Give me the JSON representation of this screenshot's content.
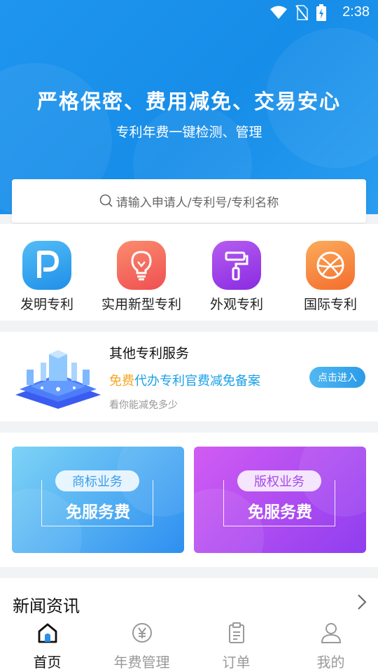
{
  "status_bar": {
    "time": "2:38"
  },
  "hero": {
    "slogan": "严格保密、费用减免、交易安心",
    "subslogan": "专利年费一键检测、管理"
  },
  "search": {
    "placeholder": "请输入申请人/专利号/专利名称"
  },
  "categories": [
    {
      "label": "发明专利",
      "icon": "p-letter-icon",
      "color": "#2fa3ef"
    },
    {
      "label": "实用新型专利",
      "icon": "lightbulb-icon",
      "color": "#f46a5c"
    },
    {
      "label": "外观专利",
      "icon": "paint-roller-icon",
      "color": "#9b3fe6"
    },
    {
      "label": "国际专利",
      "icon": "basketball-icon",
      "color": "#f7843a"
    }
  ],
  "service": {
    "title": "其他专利服务",
    "free": "免费",
    "desc": "代办专利官费减免备案",
    "hint": "看你能减免多少",
    "button": "点击进入"
  },
  "banners": [
    {
      "tag": "商标业务",
      "text": "免服务费"
    },
    {
      "tag": "版权业务",
      "text": "免服务费"
    }
  ],
  "news": {
    "title": "新闻资讯"
  },
  "tabbar": [
    {
      "label": "首页",
      "icon": "home-icon",
      "active": true
    },
    {
      "label": "年费管理",
      "icon": "yen-icon",
      "active": false
    },
    {
      "label": "订单",
      "icon": "clipboard-icon",
      "active": false
    },
    {
      "label": "我的",
      "icon": "user-icon",
      "active": false
    }
  ]
}
